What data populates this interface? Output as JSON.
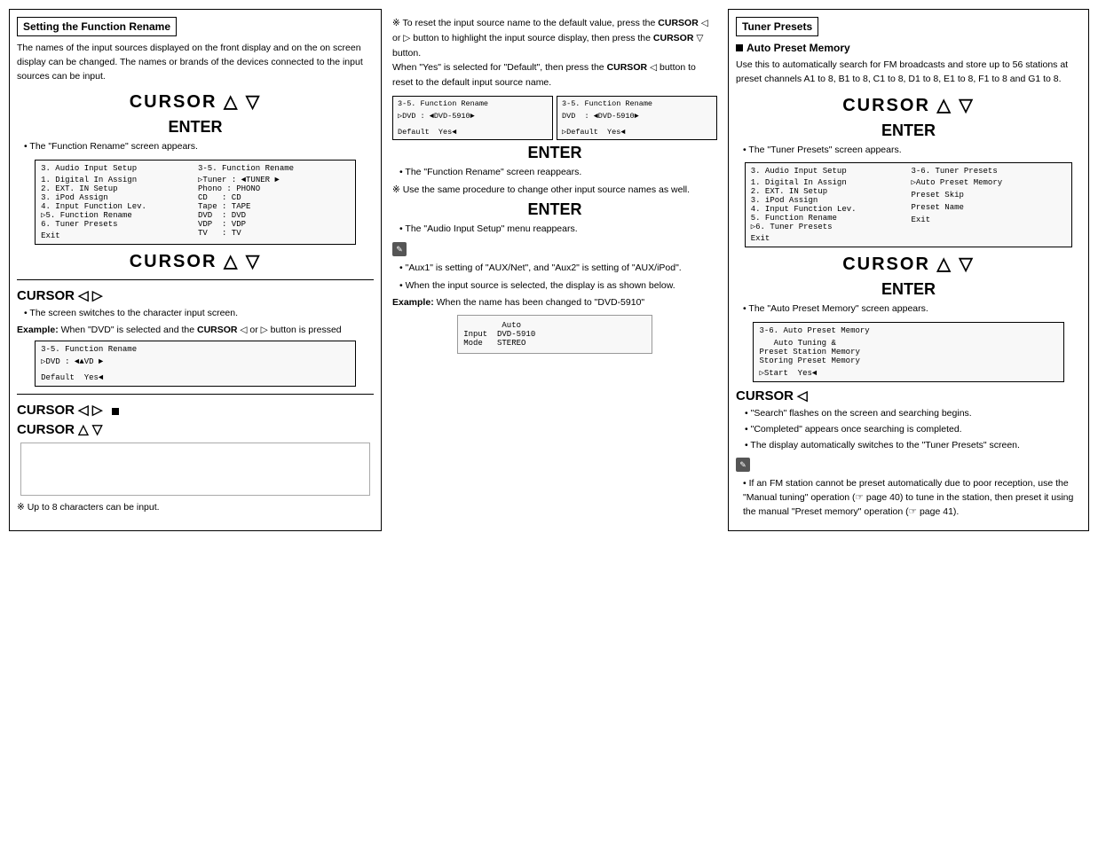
{
  "left": {
    "section_title": "Setting the Function Rename",
    "body_text": "The names of the input sources displayed on the front display and on the on screen display can be changed. The names or brands of the devices connected to the input sources can be input.",
    "cursor1": "CURSOR △   ▽",
    "enter1": "ENTER",
    "bullet1": "The \"Function Rename\" screen appears.",
    "screen1": {
      "col1": [
        "3. Audio Input Setup",
        "",
        "1. Digital In Assign",
        "2. EXT. IN Setup",
        "3. iPod Assign",
        "4. Input Function Lev.",
        "☞5. Function Rename",
        "6. Tuner Presets",
        "",
        "Exit"
      ],
      "col2": [
        "3-5. Function Rename",
        "",
        "☞Tuner : ◄TUNER ▶",
        "Phono : PHONO",
        "CD   : CD",
        "Tape : TAPE",
        "DVD  : DVD",
        "VDP  : VDP",
        "TV   : TV",
        ""
      ]
    },
    "cursor2": "CURSOR △   ▽",
    "cursor3_label": "CURSOR ◁   ▷",
    "bullet3": "The screen switches to the character input screen.",
    "example_label": "Example:",
    "example_text": "When \"DVD\" is selected and the CURSOR ◁ or ▷ button is pressed",
    "screen2": {
      "lines": [
        "3-5. Function Rename",
        "",
        "☞DVD : ◄▲VD ▶",
        "",
        "Default  Yes◄"
      ]
    },
    "cursor4": "CURSOR ◁   ▷",
    "cursor5": "CURSOR △   ▽",
    "note_footer": "※ Up to 8 characters can be input."
  },
  "middle": {
    "asterisk1": "※ To reset the input source name to the default value, press the CURSOR ◁ or ▷ button to highlight the input source display, then press the CURSOR ▽ button.",
    "asterisk1b": "When \"Yes\" is selected for \"Default\", then press the CURSOR ◁ button to reset to the default input source name.",
    "screen_pair": {
      "left": [
        "3-5. Function Rename",
        "",
        "☞DVD : ◄DVD-5910▶",
        "",
        "Default  Yes◄"
      ],
      "right": [
        "3-5. Function Rename",
        "",
        "DVD  : ◄DVD-5910▶",
        "",
        "☞Default  Yes◄"
      ]
    },
    "enter2": "ENTER",
    "bullet_enter2": "The \"Function Rename\" screen reappears.",
    "asterisk2": "※ Use the same procedure to change other input source names as well.",
    "enter3": "ENTER",
    "bullet_enter3": "The \"Audio Input Setup\" menu reappears.",
    "note_icon": "✎",
    "note1": "\"Aux1\" is setting of \"AUX/Net\", and \"Aux2\" is setting of \"AUX/iPod\".",
    "note2": "When the input source is selected, the display is as shown below.",
    "example2_label": "Example:",
    "example2_text": "When the name has been changed to \"DVD-5910\"",
    "example2_screen": [
      "Auto",
      "Input  DVD-5910",
      "Mode   STEREO"
    ]
  },
  "right": {
    "section_title": "Tuner Presets",
    "auto_preset_title": "■ Auto Preset Memory",
    "auto_preset_body": "Use this to automatically search for FM broadcasts and store up to 56 stations at preset channels A1 to 8, B1 to 8, C1 to 8, D1 to 8, E1 to 8, F1 to 8 and G1 to 8.",
    "cursor_r1": "CURSOR △   ▽",
    "enter_r1": "ENTER",
    "bullet_r1": "The \"Tuner Presets\" screen appears.",
    "screen_r1": {
      "col1": [
        "3. Audio Input Setup",
        "",
        "1. Digital In Assign",
        "2. EXT. IN Setup",
        "3. iPod Assign",
        "4. Input Function Lev.",
        "5. Function Rename",
        "☞6. Tuner Presets",
        "",
        "Exit"
      ],
      "col2": [
        "3-6. Tuner Presets",
        "",
        "☞Auto Preset Memory",
        "",
        "Preset Skip",
        "",
        "Preset Name",
        "",
        "",
        "Exit"
      ]
    },
    "cursor_r2": "CURSOR △   ▽",
    "enter_r2": "ENTER",
    "bullet_r2": "The \"Auto Preset Memory\" screen appears.",
    "screen_r2": {
      "lines": [
        "3-6. Auto Preset Memory",
        "",
        "Auto Tuning &",
        "Preset Station Memory",
        "Storing Preset Memory",
        "",
        "☞Start  Yes◄"
      ]
    },
    "cursor_r3": "CURSOR ◁",
    "bullets_r3": [
      "\"Search\" flashes on the screen and searching begins.",
      "\"Completed\" appears once searching is completed.",
      "The display automatically switches to the \"Tuner Presets\" screen."
    ],
    "note_icon": "✎",
    "note_r1": "If an FM station cannot be preset automatically due to poor reception, use the \"Manual tuning\" operation (☞ page 40) to tune in the station, then preset it using the manual \"Preset memory\" operation (☞ page 41)."
  }
}
